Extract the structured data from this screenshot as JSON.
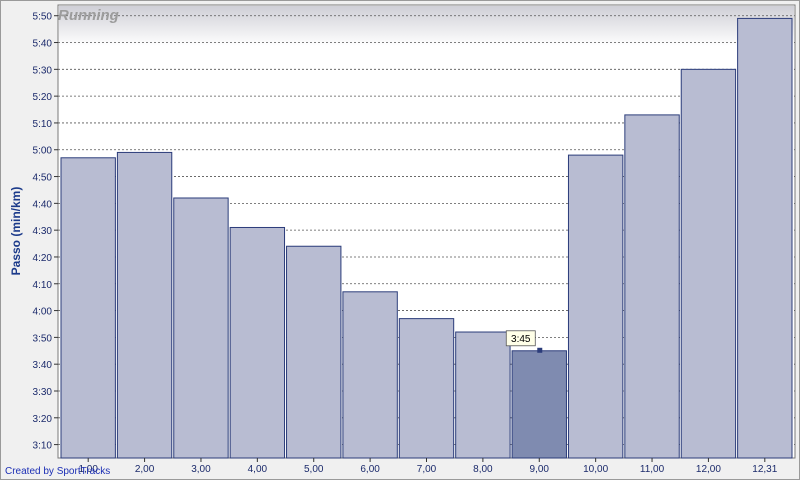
{
  "credit": "Created by SportTracks",
  "colors": {
    "bar_fill": "#b8bcd2",
    "bar_stroke": "#2b3c7a",
    "bar_highlight": "#7f8bb0",
    "plot_bg": "#ffffff",
    "grid": "#555555",
    "title_bg_top": "#cfcfd6",
    "title_bg_bottom": "#ffffff"
  },
  "chart_data": {
    "type": "bar",
    "title": "Running",
    "ylabel": "Passo (min/km)",
    "xlabel": "",
    "categories": [
      "1,00",
      "2,00",
      "3,00",
      "4,00",
      "5,00",
      "6,00",
      "7,00",
      "8,00",
      "9,00",
      "10,00",
      "11,00",
      "12,00",
      "12,31"
    ],
    "values_seconds_per_km": [
      297,
      299,
      282,
      271,
      264,
      247,
      237,
      232,
      225,
      298,
      313,
      330,
      349
    ],
    "values_label": [
      "4:57",
      "4:59",
      "4:42",
      "4:31",
      "4:24",
      "4:07",
      "3:57",
      "3:52",
      "3:45",
      "4:58",
      "5:13",
      "5:30",
      "5:49"
    ],
    "ylim_seconds": [
      185,
      354
    ],
    "yticks": [
      "3:10",
      "3:20",
      "3:30",
      "3:40",
      "3:50",
      "4:00",
      "4:10",
      "4:20",
      "4:30",
      "4:40",
      "4:50",
      "5:00",
      "5:10",
      "5:20",
      "5:30",
      "5:40",
      "5:50"
    ],
    "ytick_seconds": [
      190,
      200,
      210,
      220,
      230,
      240,
      250,
      260,
      270,
      280,
      290,
      300,
      310,
      320,
      330,
      340,
      350
    ],
    "grid": true,
    "highlighted_index": 8,
    "tooltip": "3:45"
  }
}
